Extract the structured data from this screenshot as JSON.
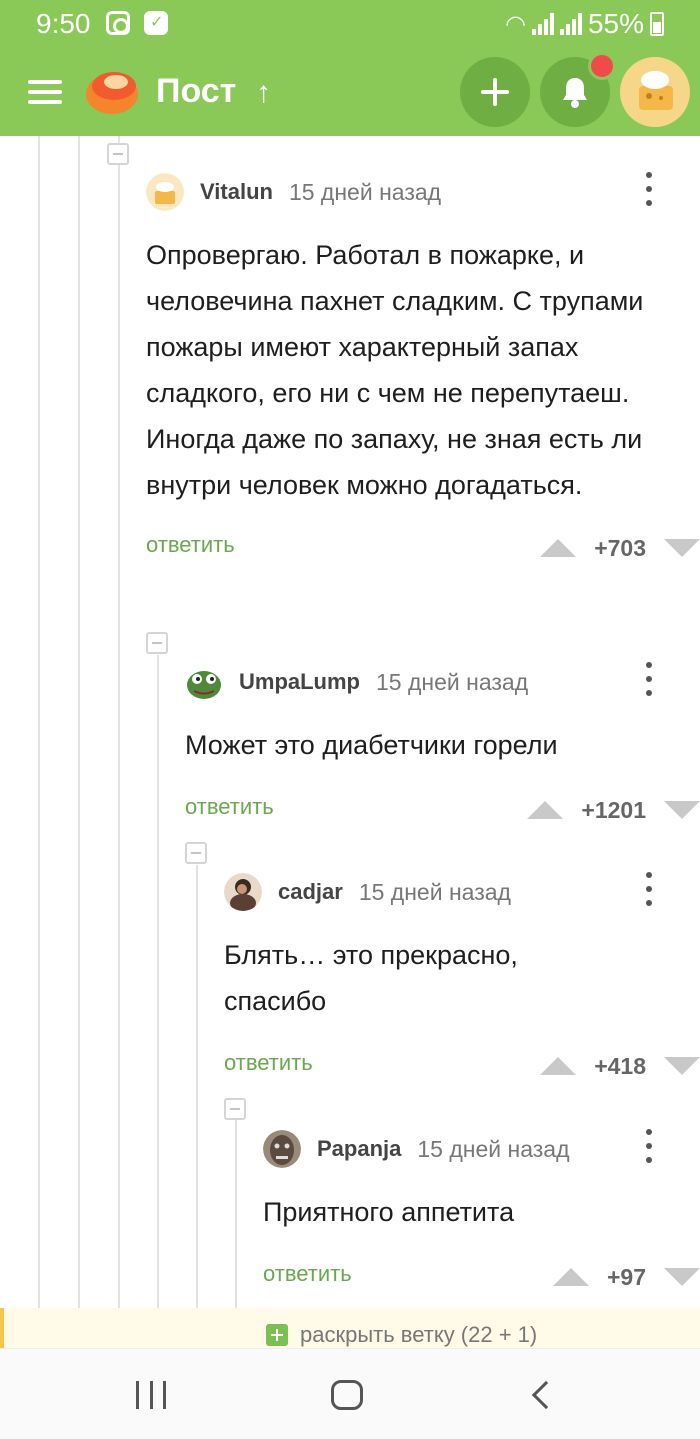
{
  "status_bar": {
    "time": "9:50",
    "battery": "55%"
  },
  "appbar": {
    "title": "Пост",
    "icons": [
      "menu-icon",
      "pikabu-logo",
      "arrow-up-icon",
      "plus-icon",
      "bell-icon",
      "user-avatar"
    ]
  },
  "comments": [
    {
      "user": "Vitalun",
      "time": "15 дней назад",
      "text": "Опровергаю. Работал в пожарке, и человечина пахнет сладким. С трупами пожары имеют характерный запах сладкого, его ни с чем не перепутаеш. Иногда даже по запаху, не зная есть ли внутри человек можно догадаться.",
      "reply": "ответить",
      "score": "+703"
    },
    {
      "user": "UmpaLump",
      "time": "15 дней назад",
      "text": "Может это диабетчики горели",
      "reply": "ответить",
      "score": "+1201"
    },
    {
      "user": "cadjar",
      "time": "15 дней назад",
      "text": "Блять… это прекрасно, спасибо",
      "reply": "ответить",
      "score": "+418"
    },
    {
      "user": "Papanja",
      "time": "15 дней назад",
      "text": "Приятного аппетита",
      "reply": "ответить",
      "score": "+97"
    }
  ],
  "expand_branch": "раскрыть ветку (22 + 1)",
  "colors": {
    "brand_green": "#8ac858",
    "reply_green": "#6aa84f",
    "notif_red": "#f04a4a"
  }
}
